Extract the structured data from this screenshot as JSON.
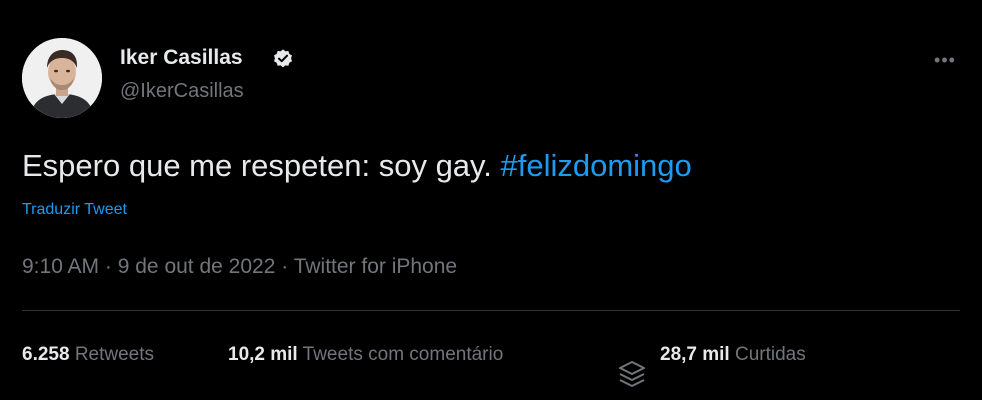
{
  "author": {
    "display_name": "Iker Casillas",
    "handle": "@IkerCasillas",
    "verified": true
  },
  "more_icon": "more-horizontal-icon",
  "tweet": {
    "text": "Espero que me respeten: soy gay. ",
    "hashtag": "#felizdomingo",
    "translate_label": "Traduzir Tweet",
    "time": "9:10 AM",
    "separator": " · ",
    "date": "9 de out de 2022",
    "source": "Twitter for iPhone"
  },
  "stats": {
    "retweets": {
      "value": "6.258",
      "label": "Retweets"
    },
    "quotes": {
      "value": "10,2 mil",
      "label": "Tweets com comentário"
    },
    "likes": {
      "value": "28,7 mil",
      "label": "Curtidas"
    }
  },
  "colors": {
    "background": "#000000",
    "text": "#e7e9ea",
    "secondary": "#71767b",
    "accent": "#1d9bf0",
    "divider": "#2f3336"
  }
}
